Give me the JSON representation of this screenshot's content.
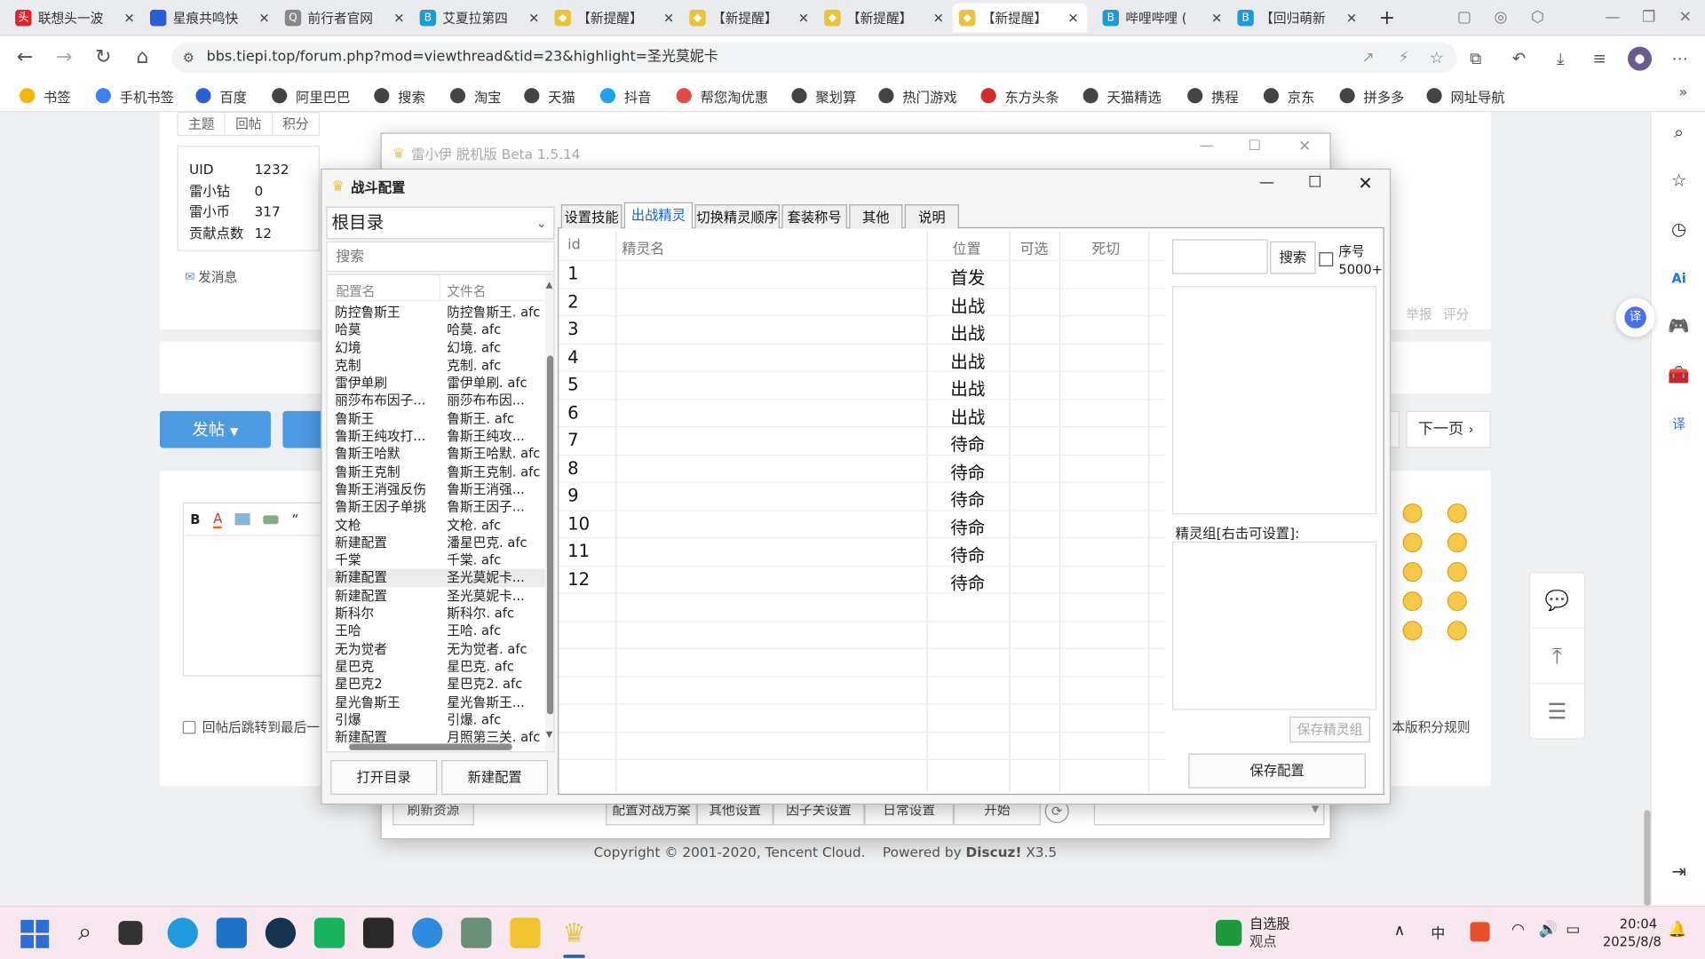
{
  "browser": {
    "tabs": [
      {
        "title": "联想头一波",
        "color": "#d9262c",
        "fav": "头"
      },
      {
        "title": "星痕共鸣快",
        "color": "#2f5bd6",
        "fav": "🐾"
      },
      {
        "title": "前行者官网",
        "color": "#888888",
        "fav": "Q"
      },
      {
        "title": "艾夏拉第四",
        "color": "#1e9bd7",
        "fav": "B"
      },
      {
        "title": "【新提醒】",
        "color": "#e9c43a",
        "fav": "◆"
      },
      {
        "title": "【新提醒】",
        "color": "#e9c43a",
        "fav": "◆"
      },
      {
        "title": "【新提醒】",
        "color": "#e9c43a",
        "fav": "◆"
      },
      {
        "title": "【新提醒】",
        "color": "#e9c43a",
        "fav": "◆"
      },
      {
        "title": "哔哩哔哩 (",
        "color": "#1e9bd7",
        "fav": "B"
      },
      {
        "title": "【回归萌新",
        "color": "#1e9bd7",
        "fav": "B"
      }
    ],
    "url": "bbs.tiepi.top/forum.php?mod=viewthread&tid=23&highlight=圣光莫妮卡",
    "bookmarks": [
      "书签",
      "手机书签",
      "百度",
      "阿里巴巴",
      "搜索",
      "淘宝",
      "天猫",
      "抖音",
      "帮您淘优惠",
      "聚划算",
      "热门游戏",
      "东方头条",
      "天猫精选",
      "携程",
      "京东",
      "拼多多",
      "网址导航"
    ]
  },
  "forum": {
    "stat_tabs": [
      "主题",
      "回帖",
      "积分"
    ],
    "profile": [
      {
        "k": "UID",
        "v": "1232"
      },
      {
        "k": "雷小钻",
        "v": "0"
      },
      {
        "k": "雷小币",
        "v": "317"
      },
      {
        "k": "贡献点数",
        "v": "12"
      }
    ],
    "send_msg": "发消息",
    "post_btn": "发帖",
    "next_page": "下一页",
    "report": "举报",
    "rate": "评分",
    "jump_after_reply": "回帖后跳转到最后一",
    "score_rules": "本版积分规则",
    "footer_copyright": "Copyright © 2001-2020, Tencent Cloud.",
    "footer_powered": "Powered by",
    "footer_discuz": "Discuz!",
    "footer_ver": "X3.5"
  },
  "back_window": {
    "title": "雷小伊 脱机版 Beta 1.5.14",
    "bottom_buttons": [
      "刷新资源",
      "配置对战方案",
      "其他设置",
      "因子关设置",
      "日常设置",
      "开始"
    ]
  },
  "battle_window": {
    "title": "战斗配置",
    "dropdown": "根目录",
    "search_placeholder": "搜索",
    "list_headers": [
      "配置名",
      "文件名"
    ],
    "configs": [
      {
        "name": "防控鲁斯王",
        "file": "防控鲁斯王. afc"
      },
      {
        "name": "哈莫",
        "file": "哈莫. afc"
      },
      {
        "name": "幻境",
        "file": "幻境. afc"
      },
      {
        "name": "克制",
        "file": "克制. afc"
      },
      {
        "name": "雷伊单刷",
        "file": "雷伊单刷. afc"
      },
      {
        "name": "丽莎布布因子...",
        "file": "丽莎布布因..."
      },
      {
        "name": "鲁斯王",
        "file": "鲁斯王. afc"
      },
      {
        "name": "鲁斯王纯攻打...",
        "file": "鲁斯王纯攻..."
      },
      {
        "name": "鲁斯王哈默",
        "file": "鲁斯王哈默. afc"
      },
      {
        "name": "鲁斯王克制",
        "file": "鲁斯王克制. afc"
      },
      {
        "name": "鲁斯王消强反伤",
        "file": "鲁斯王消强..."
      },
      {
        "name": "鲁斯王因子单挑",
        "file": "鲁斯王因子..."
      },
      {
        "name": "文枪",
        "file": "文枪. afc"
      },
      {
        "name": "新建配置",
        "file": "潘星巴克. afc"
      },
      {
        "name": "千棠",
        "file": "千棠. afc"
      },
      {
        "name": "新建配置",
        "file": "圣光莫妮卡...",
        "selected": true
      },
      {
        "name": "新建配置",
        "file": "圣光莫妮卡..."
      },
      {
        "name": "斯科尔",
        "file": "斯科尔. afc"
      },
      {
        "name": "王哈",
        "file": "王哈. afc"
      },
      {
        "name": "无为觉者",
        "file": "无为觉者. afc"
      },
      {
        "name": "星巴克",
        "file": "星巴克. afc"
      },
      {
        "name": "星巴克2",
        "file": "星巴克2. afc"
      },
      {
        "name": "星光鲁斯王",
        "file": "星光鲁斯王..."
      },
      {
        "name": "引爆",
        "file": "引爆. afc"
      },
      {
        "name": "新建配置",
        "file": "月照第三关. afc"
      }
    ],
    "open_dir": "打开目录",
    "new_config": "新建配置",
    "tabs": [
      {
        "label": "设置技能",
        "selected": false
      },
      {
        "label": "出战精灵",
        "selected": true
      },
      {
        "label": "切换精灵顺序",
        "selected": false
      },
      {
        "label": "套装称号",
        "selected": false
      },
      {
        "label": "其他",
        "selected": false
      },
      {
        "label": "说明",
        "selected": false
      }
    ],
    "grid_headers": [
      "id",
      "精灵名",
      "位置",
      "可选",
      "死切"
    ],
    "rows": [
      {
        "id": "1",
        "pos": "首发"
      },
      {
        "id": "2",
        "pos": "出战"
      },
      {
        "id": "3",
        "pos": "出战"
      },
      {
        "id": "4",
        "pos": "出战"
      },
      {
        "id": "5",
        "pos": "出战"
      },
      {
        "id": "6",
        "pos": "出战"
      },
      {
        "id": "7",
        "pos": "待命"
      },
      {
        "id": "8",
        "pos": "待命"
      },
      {
        "id": "9",
        "pos": "待命"
      },
      {
        "id": "10",
        "pos": "待命"
      },
      {
        "id": "11",
        "pos": "待命"
      },
      {
        "id": "12",
        "pos": "待命"
      }
    ],
    "search_btn": "搜索",
    "seq_label": "序号",
    "seq_sub": "5000+",
    "group_label": "精灵组[右击可设置]:",
    "save_group": "保存精灵组",
    "save_config": "保存配置"
  },
  "taskbar": {
    "stock_title": "自选股",
    "stock_sub": "观点",
    "ime": "中",
    "time": "20:04",
    "date": "2025/8/8"
  }
}
